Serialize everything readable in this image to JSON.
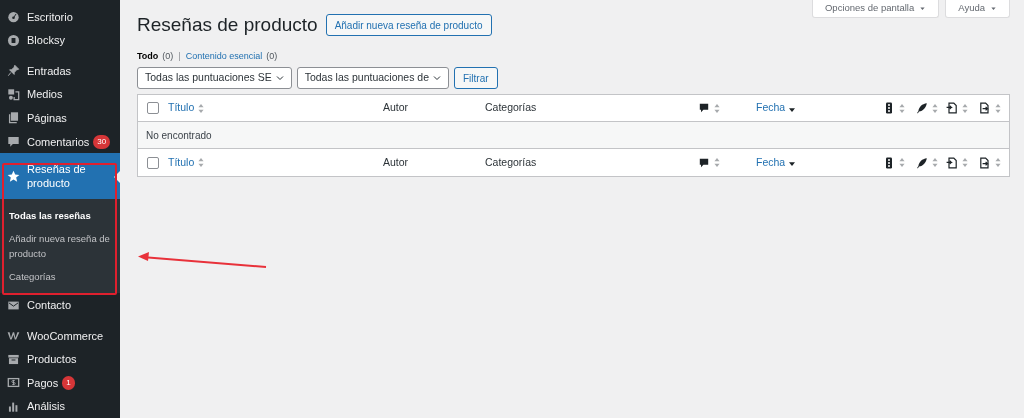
{
  "sidebar": {
    "items": [
      {
        "label": "Escritorio",
        "group_start": false,
        "selected": false
      },
      {
        "label": "Blocksy",
        "group_start": false,
        "selected": false
      },
      {
        "label": "Entradas",
        "group_start": true,
        "selected": false
      },
      {
        "label": "Medios",
        "group_start": false,
        "selected": false
      },
      {
        "label": "Páginas",
        "group_start": false,
        "selected": false
      },
      {
        "label": "Comentarios",
        "group_start": false,
        "selected": false,
        "badge": "30"
      },
      {
        "label": "Reseñas de producto",
        "group_start": false,
        "selected": true,
        "submenu": [
          {
            "label": "Todas las reseñas",
            "selected": true
          },
          {
            "label": "Añadir nueva reseña de producto",
            "selected": false
          },
          {
            "label": "Categorías",
            "selected": false
          }
        ]
      },
      {
        "label": "Contacto",
        "group_start": false,
        "selected": false
      },
      {
        "label": "WooCommerce",
        "group_start": true,
        "selected": false
      },
      {
        "label": "Productos",
        "group_start": false,
        "selected": false
      },
      {
        "label": "Pagos",
        "group_start": false,
        "selected": false,
        "badge": "1"
      },
      {
        "label": "Análisis",
        "group_start": false,
        "selected": false
      }
    ]
  },
  "screen_tabs": [
    "Opciones de pantalla",
    "Ayuda"
  ],
  "page_title": "Reseñas de producto",
  "add_button": "Añadir nueva reseña de producto",
  "views": [
    {
      "label": "Todo",
      "count": "(0)",
      "selected": true
    },
    {
      "separator": "|",
      "label": "Contenido esencial",
      "count": "(0)",
      "selected": false
    }
  ],
  "filters": [
    "Todas las puntuaciones SE",
    "Todas las puntuaciones de"
  ],
  "filter_button": "Filtrar",
  "table": {
    "header": {
      "checked": false,
      "columns": [
        {
          "label": "Título",
          "sortable": true,
          "sorted": false
        },
        {
          "label": "Autor",
          "sortable": false
        },
        {
          "label": "Categorías",
          "sortable": false
        },
        {
          "sortable": true,
          "sorted": false
        },
        {
          "label": "Fecha",
          "sortable": true,
          "sorted": true
        },
        {
          "sortable": true,
          "sorted": false
        },
        {
          "sortable": true,
          "sorted": false
        },
        {
          "sortable": true,
          "sorted": false
        },
        {
          "sortable": true,
          "sorted": false
        }
      ]
    },
    "empty_message": "No encontrado",
    "footer": {
      "checked": false,
      "columns": [
        {
          "label": "Título",
          "sortable": true,
          "sorted": false
        },
        {
          "label": "Autor",
          "sortable": false
        },
        {
          "label": "Categorías",
          "sortable": false
        },
        {
          "sortable": true,
          "sorted": false
        },
        {
          "label": "Fecha",
          "sortable": true,
          "sorted": true
        },
        {
          "sortable": true,
          "sorted": false
        },
        {
          "sortable": true,
          "sorted": false
        },
        {
          "sortable": true,
          "sorted": false
        },
        {
          "sortable": true,
          "sorted": false
        }
      ]
    }
  },
  "annotation": {
    "highlight_box": true,
    "arrow": true
  }
}
